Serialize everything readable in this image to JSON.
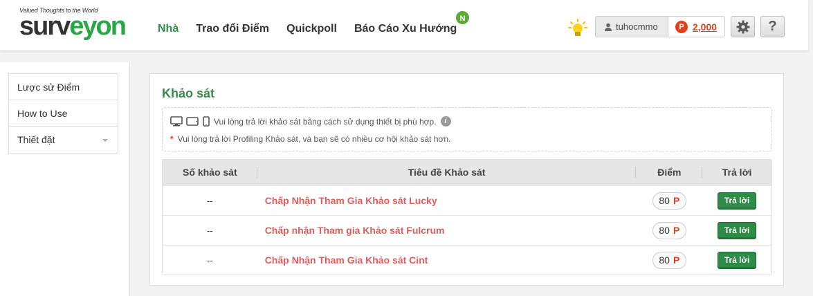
{
  "header": {
    "logo_tagline": "Valued Thoughts to the World",
    "logo_part1": "surv",
    "logo_part2": "eyon",
    "nav": [
      {
        "label": "Nhà",
        "active": true
      },
      {
        "label": "Trao đổi Điểm"
      },
      {
        "label": "Quickpoll"
      },
      {
        "label": "Báo Cáo Xu Hướng"
      }
    ],
    "new_badge": "N",
    "username": "tuhocmmo",
    "points_symbol": "P",
    "points": "2,000",
    "help_label": "?"
  },
  "sidebar": {
    "items": [
      {
        "label": "Lược sử Điểm"
      },
      {
        "label": "How to Use"
      },
      {
        "label": "Thiết đặt"
      }
    ]
  },
  "main": {
    "title": "Khảo sát",
    "notice_device": "Vui lòng trả lời khảo sát bằng cách sử dụng thiết bị phù hợp.",
    "notice_info_icon": "i",
    "notice_star": "*",
    "notice_profiling": "Vui lòng trả lời Profiling Khảo sát, và bạn sẽ có nhiều cơ hội khảo sát hơn.",
    "table": {
      "columns": [
        "Số khảo sát",
        "Tiêu đề Khảo sát",
        "Điểm",
        "Trả lời"
      ],
      "rows": [
        {
          "number": "--",
          "title": "Chấp Nhận Tham Gia Khảo sát Lucky",
          "points": "80",
          "points_symbol": "P",
          "action": "Trả lời"
        },
        {
          "number": "--",
          "title": "Chấp nhận Tham gia Khảo sát Fulcrum",
          "points": "80",
          "points_symbol": "P",
          "action": "Trả lời"
        },
        {
          "number": "--",
          "title": "Chấp Nhận Tham Gia Khảo sát Cint",
          "points": "80",
          "points_symbol": "P",
          "action": "Trả lời"
        }
      ]
    }
  },
  "colors": {
    "brand_green": "#27a844",
    "nav_active": "#2f8e4f",
    "points_red": "#e2401c",
    "survey_title": "#e35c5c",
    "button_green": "#2e8b48"
  },
  "icons": [
    "user-icon",
    "bulb-icon",
    "gear-icon",
    "help-icon",
    "desktop-icon",
    "tablet-icon",
    "phone-icon",
    "info-icon",
    "caret-down-icon"
  ]
}
